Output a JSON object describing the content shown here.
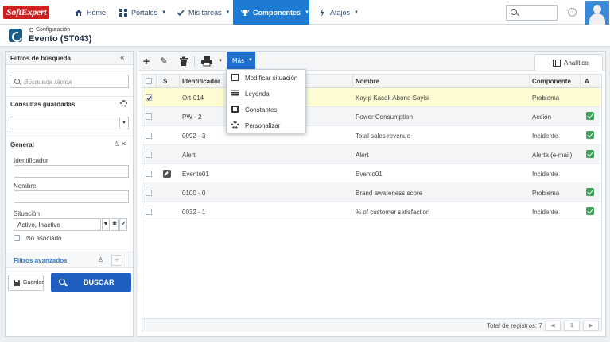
{
  "app": {
    "logo": "SoftExpert",
    "nav": [
      {
        "label": "Home",
        "icon": "home-icon"
      },
      {
        "label": "Portales",
        "icon": "grid-icon"
      },
      {
        "label": "Mis tareas",
        "icon": "checkmark-icon"
      },
      {
        "label": "Componentes",
        "icon": "trophy-icon"
      },
      {
        "label": "Atajos",
        "icon": "lightning-icon"
      }
    ],
    "active_nav": "Componentes",
    "accent_color": "#1e7bd3"
  },
  "page": {
    "breadcrumb": "Configuración",
    "title": "Evento (ST043)"
  },
  "filters": {
    "header": "Filtros de búsqueda",
    "quick_search_placeholder": "Búsqueda rápida",
    "saved_queries_label": "Consultas guardadas",
    "general_label": "General",
    "identificador_label": "Identificador",
    "nombre_label": "Nombre",
    "situacion_label": "Situación",
    "situacion_value": "Activo, Inactivo",
    "no_asociado_label": "No asociado",
    "advanced_label": "Filtros avanzados",
    "save_label": "Guardar",
    "search_label": "BUSCAR"
  },
  "toolbar": {
    "mas_label": "Más",
    "analitico_label": "Analítico"
  },
  "menu": {
    "items": [
      {
        "label": "Modificar situación",
        "icon": "document-icon"
      },
      {
        "label": "Leyenda",
        "icon": "list-icon"
      },
      {
        "label": "Constantes",
        "icon": "constants-icon"
      },
      {
        "label": "Personalizar",
        "icon": "gear-icon"
      }
    ]
  },
  "table": {
    "columns": [
      "S",
      "Identificador",
      "Nombre",
      "Componente",
      "A"
    ],
    "rows": [
      {
        "id": "Ort-014",
        "name": "Kayip Kacak Abone Sayisi",
        "component": "Problema",
        "checked": true,
        "a": false,
        "edit": false
      },
      {
        "id": "PW - 2",
        "name": "Power Consumption",
        "component": "Acción",
        "checked": false,
        "a": true,
        "edit": false
      },
      {
        "id": "0092 - 3",
        "name": "Total sales revenue",
        "component": "Incidente",
        "checked": false,
        "a": true,
        "edit": false
      },
      {
        "id": "Alert",
        "name": "Alert",
        "component": "Alerta (e-mail)",
        "checked": false,
        "a": true,
        "edit": false
      },
      {
        "id": "Evento01",
        "name": "Evento01",
        "component": "Incidente",
        "checked": false,
        "a": false,
        "edit": true
      },
      {
        "id": "0100 - 0",
        "name": "Brand awareness score",
        "component": "Problema",
        "checked": false,
        "a": true,
        "edit": false
      },
      {
        "id": "0032 - 1",
        "name": "% of customer satisfaction",
        "component": "Incidente",
        "checked": false,
        "a": true,
        "edit": false
      }
    ],
    "total_label": "Total de registros: 7",
    "page_number": "1"
  }
}
